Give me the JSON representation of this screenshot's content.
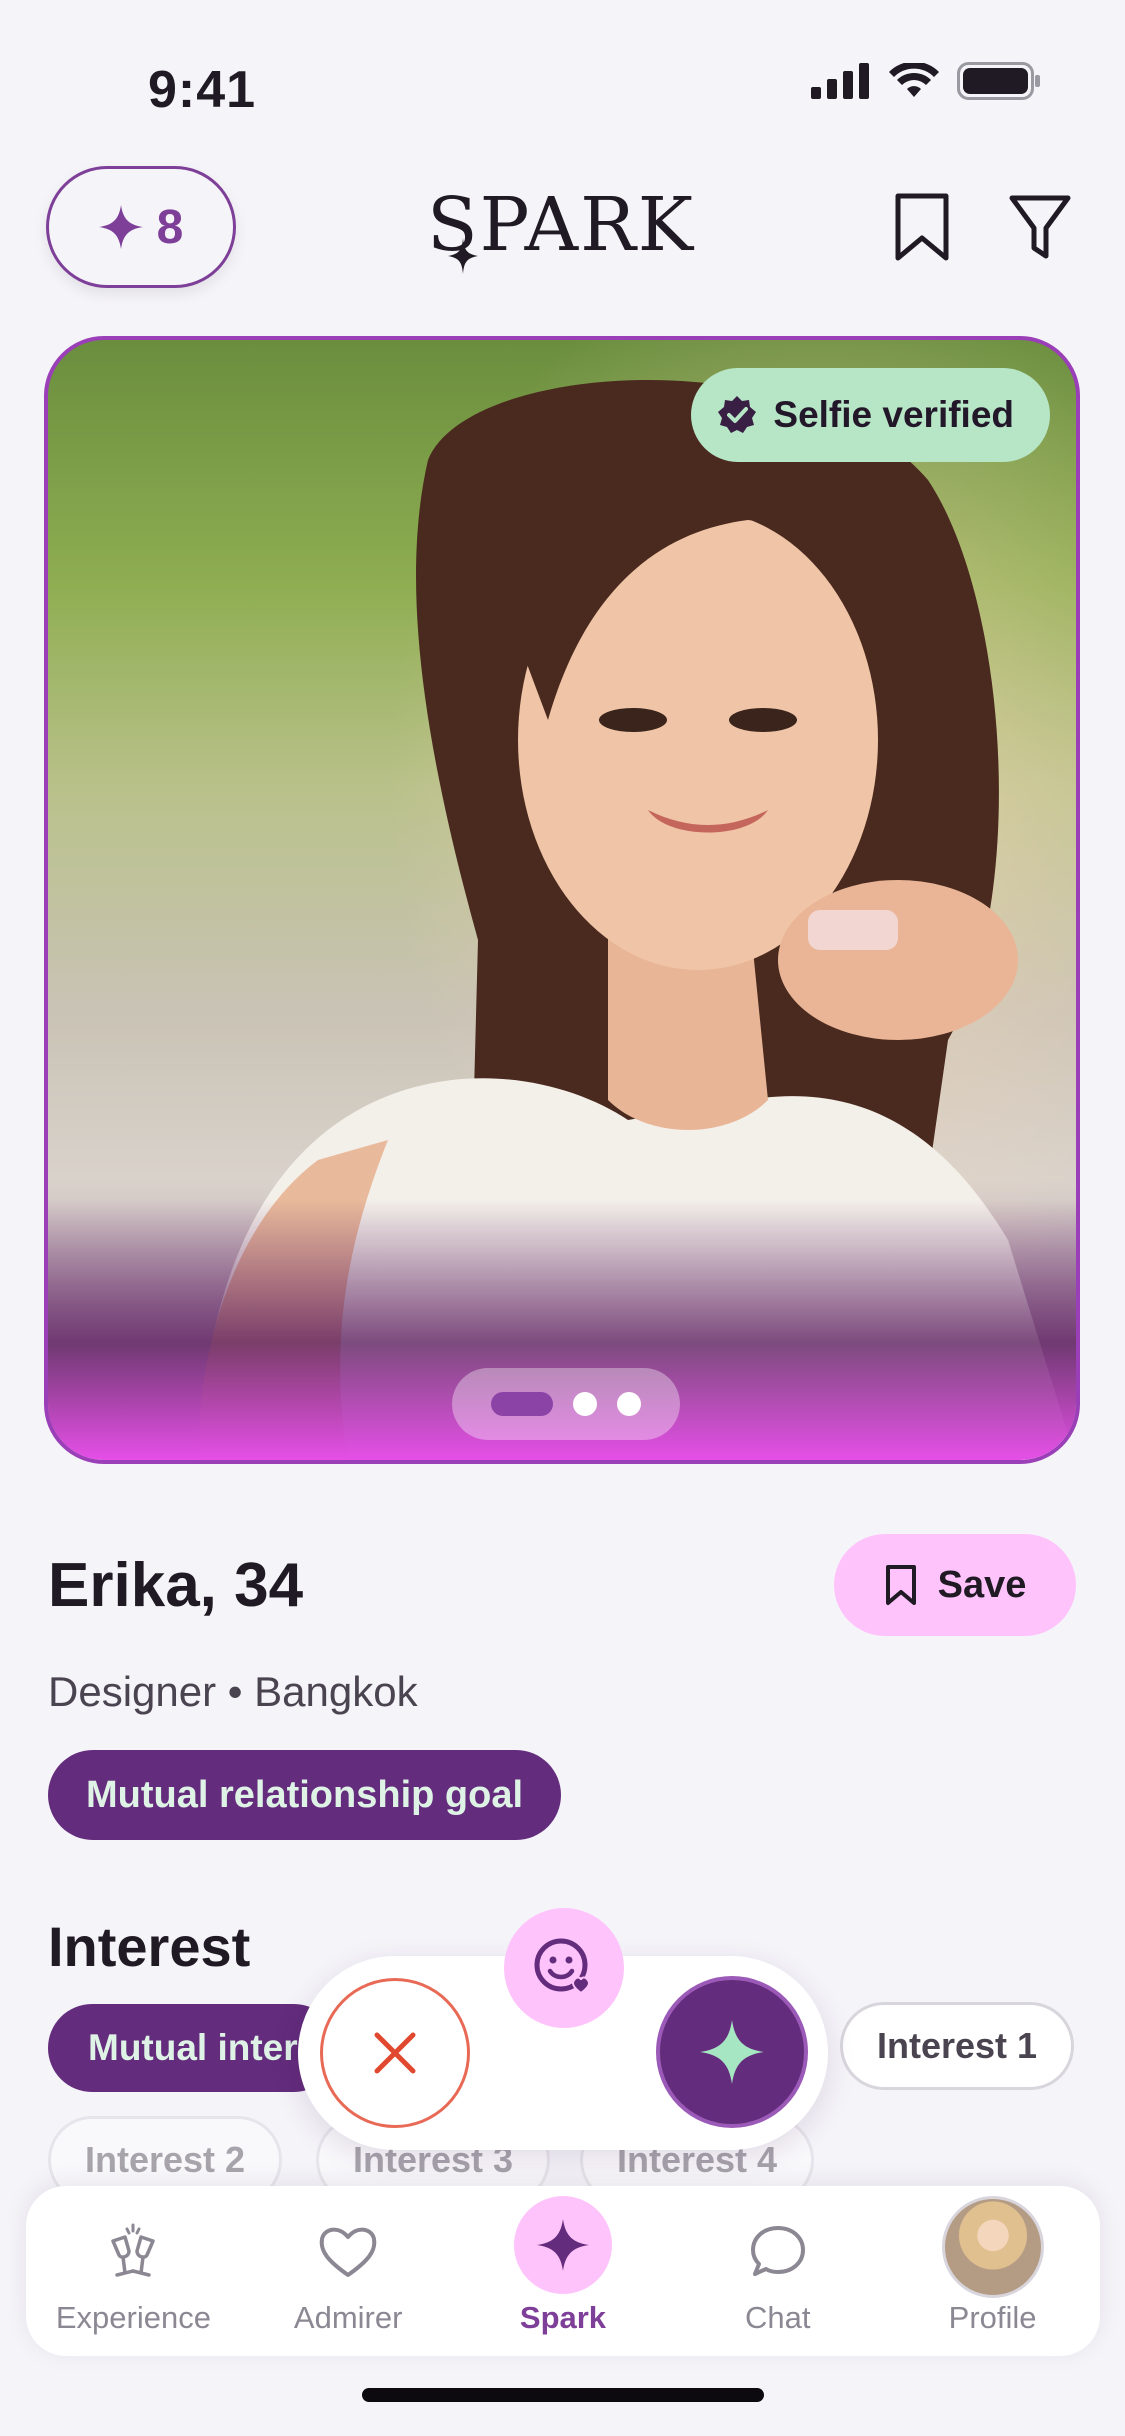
{
  "status_bar": {
    "time": "9:41",
    "icons": [
      "signal-icon",
      "wifi-icon",
      "battery-icon"
    ]
  },
  "header": {
    "spark_count": "8",
    "logo_text": "SPARK",
    "icons": [
      "bookmark-icon",
      "filter-icon"
    ]
  },
  "photo": {
    "badge": "Selfie verified",
    "pager": {
      "count": 3,
      "active": 1
    }
  },
  "profile": {
    "name_age": "Erika, 34",
    "occupation_location": "Designer • Bangkok",
    "save_label": "Save",
    "goal_chip": "Mutual relationship goal"
  },
  "interest": {
    "title": "Interest",
    "mutual_chip": "Mutual inter",
    "chips": [
      "Interest 1",
      "Interest 2",
      "Interest 3",
      "Interest 4"
    ]
  },
  "nav": {
    "items": [
      {
        "label": "Experience",
        "icon": "cheers-icon"
      },
      {
        "label": "Admirer",
        "icon": "heart-icon"
      },
      {
        "label": "Spark",
        "icon": "spark-icon",
        "active": true
      },
      {
        "label": "Chat",
        "icon": "chat-bubble-icon"
      },
      {
        "label": "Profile",
        "icon": "avatar"
      }
    ]
  },
  "colors": {
    "brand_purple": "#632c7c",
    "accent_pink": "#ffc3fb",
    "verified_green": "#b7e6c7",
    "dismiss_red": "#e86a56"
  }
}
